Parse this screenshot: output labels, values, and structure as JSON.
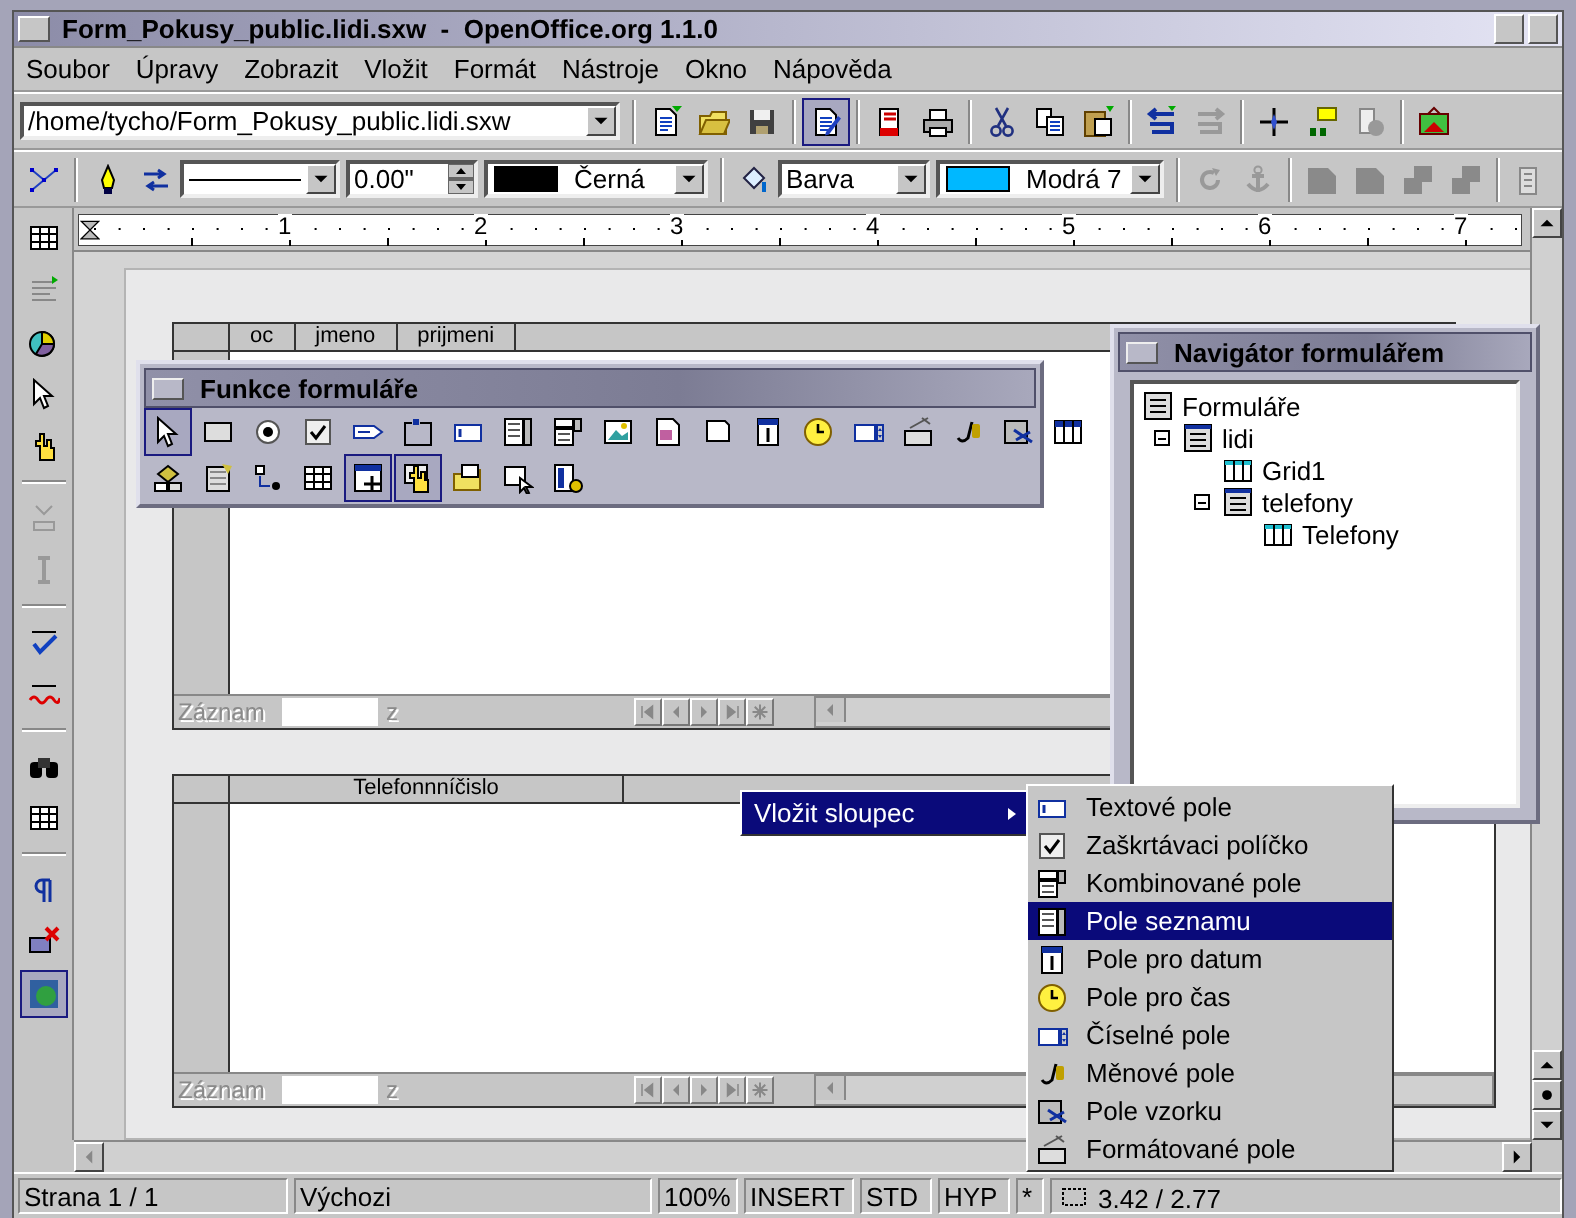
{
  "window": {
    "title": "Form_Pokusy_public.lidi.sxw  -  OpenOffice.org 1.1.0"
  },
  "menu": [
    "Soubor",
    "Úpravy",
    "Zobrazit",
    "Vložit",
    "Formát",
    "Nástroje",
    "Okno",
    "Nápověda"
  ],
  "function_bar": {
    "url": "/home/tycho/Form_Pokusy_public.lidi.sxw",
    "buttons": [
      {
        "selected": false
      },
      {
        "selected": false
      },
      {
        "selected": false
      },
      {
        "selected": true
      },
      {
        "selected": false
      },
      {
        "selected": false
      },
      {
        "selected": false
      },
      {
        "selected": false
      },
      {
        "selected": false
      },
      {
        "selected": false
      },
      {
        "selected": false
      },
      {
        "selected": false
      },
      {
        "selected": false
      },
      {
        "selected": false
      },
      {
        "selected": false
      }
    ]
  },
  "object_bar": {
    "line_width": "0.00\"",
    "line_color": {
      "label": "Černá",
      "color": "#000000"
    },
    "area_style": "Barva",
    "area_color": {
      "label": "Modrá 7",
      "color": "#00b8ff"
    }
  },
  "left_toolbar": {
    "buttons": [
      {
        "selected": false
      },
      {
        "selected": false
      },
      {
        "selected": false
      },
      {
        "selected": false
      },
      {
        "selected": false
      },
      {
        "selected": false
      },
      {
        "selected": false
      },
      {
        "selected": false
      },
      {
        "selected": false
      },
      {
        "selected": false
      },
      {
        "selected": false
      },
      {
        "selected": false
      },
      {
        "selected": false
      },
      {
        "selected": true
      }
    ]
  },
  "ruler": {
    "labels": [
      "1",
      "2",
      "3",
      "4",
      "5",
      "6",
      "7"
    ]
  },
  "grids": [
    {
      "columns": [
        "oc",
        "jmeno",
        "prijmeni"
      ],
      "record_label": "Záznam",
      "of_label": "z"
    },
    {
      "columns": [
        "Telefonnníčislo"
      ],
      "record_label": "Záznam",
      "of_label": "z"
    }
  ],
  "form_toolbar": {
    "title": "Funkce formuláře",
    "rows": [
      [
        {
          "selected": true
        },
        {
          "selected": false
        },
        {
          "selected": false
        },
        {
          "selected": false
        },
        {
          "selected": false
        },
        {
          "selected": false
        },
        {
          "selected": false
        },
        {
          "selected": false
        },
        {
          "selected": false
        },
        {
          "selected": false
        },
        {
          "selected": false
        },
        {
          "selected": false
        },
        {
          "selected": false
        },
        {
          "selected": false
        },
        {
          "selected": false
        },
        {
          "selected": false
        },
        {
          "selected": false
        },
        {
          "selected": false
        },
        {
          "selected": false
        }
      ],
      [
        {
          "selected": false
        },
        {
          "selected": false
        },
        {
          "selected": false
        },
        {
          "selected": false
        },
        {
          "selected": true
        },
        {
          "selected": true
        },
        {
          "selected": false
        },
        {
          "selected": false
        },
        {
          "selected": false
        }
      ]
    ]
  },
  "navigator": {
    "title": "Navigátor formulářem",
    "tree": [
      {
        "label": "Formuláře",
        "kind": "forms",
        "children": [
          {
            "label": "lidi",
            "kind": "form",
            "expanded": true,
            "children": [
              {
                "label": "Grid1",
                "kind": "grid"
              },
              {
                "label": "telefony",
                "kind": "form",
                "expanded": true,
                "children": [
                  {
                    "label": "Telefony",
                    "kind": "grid"
                  }
                ]
              }
            ]
          }
        ]
      }
    ]
  },
  "context_menu": {
    "items": [
      {
        "label": "Vložit sloupec",
        "selected": true
      }
    ]
  },
  "submenu": {
    "items": [
      {
        "label": "Textové pole",
        "selected": false
      },
      {
        "label": "Zaškrtávaci políčko",
        "selected": false
      },
      {
        "label": "Kombinované pole",
        "selected": false
      },
      {
        "label": "Pole seznamu",
        "selected": true
      },
      {
        "label": "Pole pro datum",
        "selected": false
      },
      {
        "label": "Pole pro čas",
        "selected": false
      },
      {
        "label": "Číselné pole",
        "selected": false
      },
      {
        "label": "Měnové pole",
        "selected": false
      },
      {
        "label": "Pole vzorku",
        "selected": false
      },
      {
        "label": "Formátované pole",
        "selected": false
      }
    ]
  },
  "status_bar": [
    "Strana 1 / 1",
    "Výchozi",
    "100%",
    "INSERT",
    "STD",
    "HYP",
    "*",
    "3.42 / 2.77"
  ]
}
